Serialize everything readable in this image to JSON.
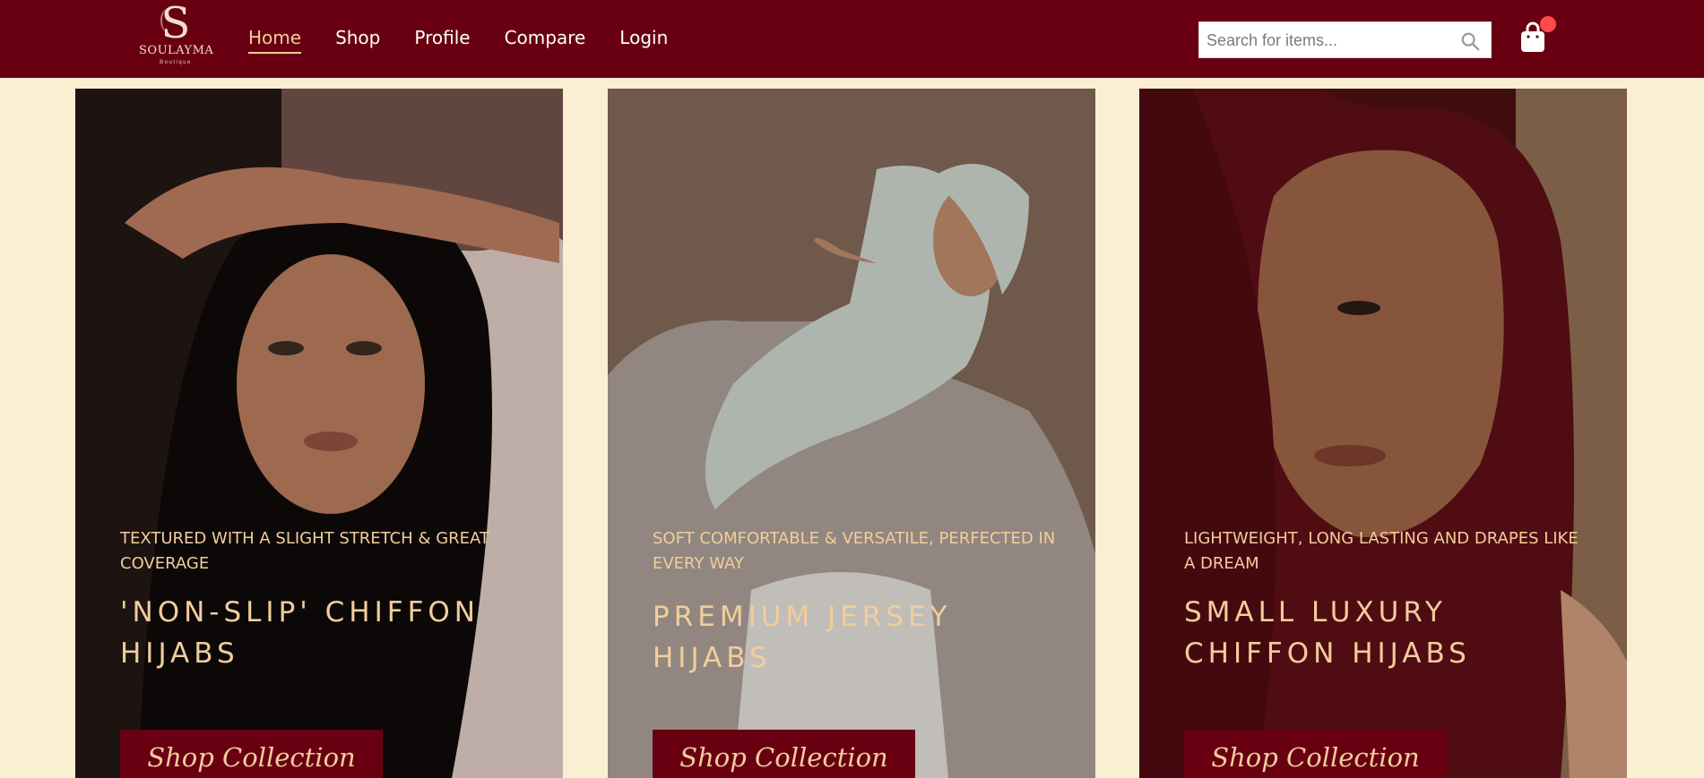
{
  "brand": {
    "monogram": "S",
    "name": "SOULAYMA",
    "subtitle": "Boutique"
  },
  "nav": [
    "Home",
    "Shop",
    "Profile",
    "Compare",
    "Login"
  ],
  "search": {
    "placeholder": "Search for items..."
  },
  "cards": [
    {
      "tagline": "TEXTURED WITH A SLIGHT STRETCH & GREAT COVERAGE",
      "title": "'NON-SLIP' CHIFFON HIJABS",
      "button": "Shop Collection"
    },
    {
      "tagline": "SOFT COMFORTABLE & VERSATILE, PERFECTED IN EVERY WAY",
      "title": "PREMIUM JERSEY HIJABS",
      "button": "Shop Collection"
    },
    {
      "tagline": "LIGHTWEIGHT, LONG LASTING AND DRAPES LIKE A DREAM",
      "title": "SMALL LUXURY CHIFFON HIJABS",
      "button": "Shop Collection"
    }
  ],
  "colors": {
    "header": "#680012",
    "accent": "#f2cd9c",
    "page": "#faeed3",
    "badge": "#ff4a4a"
  },
  "icons": {
    "search": "search-icon",
    "cart": "shopping-bag-icon"
  }
}
